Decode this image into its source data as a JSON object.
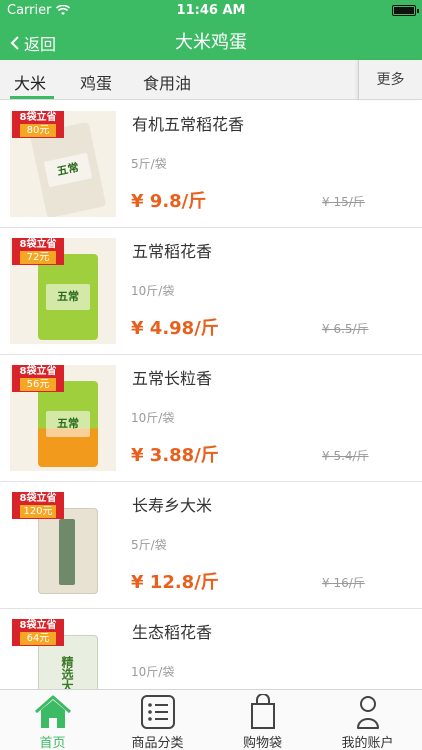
{
  "status": {
    "carrier": "Carrier",
    "time": "11:46 AM"
  },
  "nav": {
    "back_label": "返回",
    "title": "大米鸡蛋"
  },
  "tabs": [
    {
      "label": "大米"
    },
    {
      "label": "鸡蛋"
    },
    {
      "label": "食用油"
    }
  ],
  "more_label": "更多",
  "products": [
    {
      "name": "有机五常稻花香",
      "spec": "5斤/袋",
      "price": "¥ 9.8/斤",
      "old_price": "¥ 15/斤",
      "promo_line1": "8袋立省",
      "promo_line2": "80元",
      "bag_text": "五常"
    },
    {
      "name": "五常稻花香",
      "spec": "10斤/袋",
      "price": "¥ 4.98/斤",
      "old_price": "¥ 6.5/斤",
      "promo_line1": "8袋立省",
      "promo_line2": "72元",
      "bag_text": "五常"
    },
    {
      "name": "五常长粒香",
      "spec": "10斤/袋",
      "price": "¥ 3.88/斤",
      "old_price": "¥ 5.4/斤",
      "promo_line1": "8袋立省",
      "promo_line2": "56元",
      "bag_text": "五常"
    },
    {
      "name": "长寿乡大米",
      "spec": "5斤/袋",
      "price": "¥ 12.8/斤",
      "old_price": "¥ 16/斤",
      "promo_line1": "8袋立省",
      "promo_line2": "120元",
      "bag_text": ""
    },
    {
      "name": "生态稻花香",
      "spec": "10斤/袋",
      "price": "",
      "old_price": "",
      "promo_line1": "8袋立省",
      "promo_line2": "64元",
      "bag_text": "精选大米"
    }
  ],
  "tabbar": [
    {
      "label": "首页",
      "icon": "home-icon"
    },
    {
      "label": "商品分类",
      "icon": "list-icon"
    },
    {
      "label": "购物袋",
      "icon": "bag-icon"
    },
    {
      "label": "我的账户",
      "icon": "person-icon"
    }
  ],
  "colors": {
    "brand_green": "#3dba64",
    "price_orange": "#e8601c",
    "promo_red": "#d8232a"
  }
}
